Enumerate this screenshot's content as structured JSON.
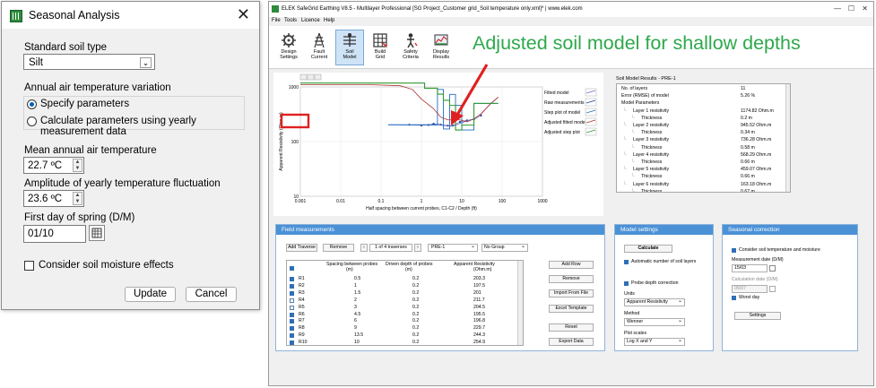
{
  "dialog": {
    "title": "Seasonal Analysis",
    "soil_type_label": "Standard soil type",
    "soil_type_value": "Silt",
    "air_temp_label": "Annual air temperature variation",
    "option_specify": "Specify parameters",
    "option_calculate": "Calculate parameters using yearly measurement data",
    "mean_temp_label": "Mean annual air temperature",
    "mean_temp_value": "22.7 ºC",
    "amplitude_label": "Amplitude of yearly temperature fluctuation",
    "amplitude_value": "23.6 ºC",
    "spring_label": "First day of spring (D/M)",
    "spring_value": "01/10",
    "moisture_label": "Consider soil moisture effects",
    "update_label": "Update",
    "cancel_label": "Cancel"
  },
  "app": {
    "title": "ELEK SafeGrid Earthing V8.5 - Multilayer Professional [SG Project_Customer grid_Soil temperature only.xml]* | www.elek.com",
    "menu": [
      "File",
      "Tools",
      "Licence",
      "Help"
    ],
    "ribbon": [
      {
        "l1": "Design",
        "l2": "Settings"
      },
      {
        "l1": "Fault",
        "l2": "Current"
      },
      {
        "l1": "Soil",
        "l2": "Model"
      },
      {
        "l1": "Build",
        "l2": "Grid"
      },
      {
        "l1": "Safety",
        "l2": "Criteria"
      },
      {
        "l1": "Display",
        "l2": "Results"
      }
    ],
    "annotation": "Adjusted soil model for shallow depths"
  },
  "chart_data": {
    "type": "line",
    "xlabel": "Half spacing between current probes, C1-C2 / Depth (ft)",
    "ylabel": "Apparent Resistivity (Ohm.m)",
    "xscale": "log",
    "yscale": "log",
    "xlim": [
      0.001,
      1000
    ],
    "ylim": [
      10,
      1000
    ],
    "x_ticks": [
      "0.001",
      "0.01",
      "0.1",
      "1",
      "10",
      "100",
      "1000"
    ],
    "y_ticks": [
      "1000",
      "100",
      "10"
    ],
    "legend": [
      "Fitted model",
      "Raw measurements",
      "Step plot of model",
      "Adjusted fitted model",
      "Adjusted step plot"
    ],
    "legend_position": "right",
    "series": [
      {
        "name": "Raw measurements",
        "x": [
          0.5,
          1,
          1.5,
          2,
          3,
          4.5,
          6,
          9,
          13.5,
          20,
          30
        ],
        "y": [
          203.3,
          197.5,
          201,
          211.7,
          204.5,
          195.5,
          196.8,
          229.7,
          244.3,
          254.9,
          300
        ]
      },
      {
        "name": "Fitted model",
        "x": [
          0.15,
          0.3,
          0.5,
          1,
          2,
          3,
          4.5,
          6,
          9,
          13.5,
          20,
          30,
          50,
          80
        ],
        "y": [
          203,
          202,
          201,
          201,
          202,
          200,
          193,
          192,
          215,
          240,
          260,
          320,
          480,
          650
        ]
      },
      {
        "name": "Step plot of model",
        "x": [
          0.15,
          2.5,
          2.5,
          3.5,
          3.5,
          5,
          5,
          7,
          7,
          10,
          10,
          20,
          20,
          80
        ],
        "y": [
          203,
          203,
          900,
          900,
          170,
          170,
          730,
          730,
          459,
          459,
          163,
          163,
          500,
          500
        ]
      },
      {
        "name": "Adjusted fitted model",
        "x": [
          0.001,
          0.05,
          0.3,
          0.6,
          1,
          2,
          3,
          4.5,
          6,
          9,
          13.5,
          20,
          30,
          50,
          80
        ],
        "y": [
          1100,
          1100,
          1050,
          900,
          600,
          400,
          280,
          250,
          250,
          250,
          230,
          260,
          320,
          480,
          650
        ]
      },
      {
        "name": "Adjusted step plot",
        "x": [
          0.001,
          1.2,
          1.2,
          2.5,
          2.5,
          3.5,
          3.5,
          5,
          5,
          7,
          7,
          10,
          10,
          20,
          20,
          80
        ],
        "y": [
          1174.82,
          1174.82,
          945.52,
          945.52,
          736.28,
          736.28,
          568.29,
          568.29,
          459.07,
          459.07,
          163.18,
          163.18,
          200,
          200,
          500,
          500
        ]
      }
    ]
  },
  "results": {
    "header": "Soil Model Results - PRE-1",
    "rows": [
      {
        "indent": 0,
        "label": "No. of layers",
        "value": "11"
      },
      {
        "indent": 0,
        "label": "Error (RMSE) of model",
        "value": "5.26 %"
      },
      {
        "indent": 0,
        "label": "Model Parameters",
        "value": ""
      },
      {
        "indent": 1,
        "label": "Layer 1 resistivity",
        "value": "1174.82 Ohm.m"
      },
      {
        "indent": 2,
        "label": "Thickness",
        "value": "0.2 m"
      },
      {
        "indent": 1,
        "label": "Layer 2 resistivity",
        "value": "945.52 Ohm.m"
      },
      {
        "indent": 2,
        "label": "Thickness",
        "value": "0.34 m"
      },
      {
        "indent": 1,
        "label": "Layer 3 resistivity",
        "value": "736.28 Ohm.m"
      },
      {
        "indent": 2,
        "label": "Thickness",
        "value": "0.58 m"
      },
      {
        "indent": 1,
        "label": "Layer 4 resistivity",
        "value": "568.29 Ohm.m"
      },
      {
        "indent": 2,
        "label": "Thickness",
        "value": "0.66 m"
      },
      {
        "indent": 1,
        "label": "Layer 5 resistivity",
        "value": "459.07 Ohm.m"
      },
      {
        "indent": 2,
        "label": "Thickness",
        "value": "0.66 m"
      },
      {
        "indent": 1,
        "label": "Layer 6 resistivity",
        "value": "163.18 Ohm.m"
      },
      {
        "indent": 2,
        "label": "Thickness",
        "value": "0.67 m"
      }
    ]
  },
  "field": {
    "header": "Field measurements",
    "add_traverse": "Add Traverse",
    "remove": "Remove",
    "traverse_count": "1 of 4 traverses",
    "traverse_name": "PRE-1",
    "group": "No Group",
    "columns": [
      "Spacing between probes\n(m)",
      "Driven depth of probes\n(m)",
      "Apparent Resistivity\n(Ohm.m)"
    ],
    "rows": [
      {
        "name": "R1",
        "s": "0.5",
        "d": "0.2",
        "r": "203.3",
        "on": true
      },
      {
        "name": "R2",
        "s": "1",
        "d": "0.2",
        "r": "197.5",
        "on": true
      },
      {
        "name": "R3",
        "s": "1.5",
        "d": "0.2",
        "r": "201",
        "on": true
      },
      {
        "name": "R4",
        "s": "2",
        "d": "0.2",
        "r": "211.7",
        "on": false
      },
      {
        "name": "R5",
        "s": "3",
        "d": "0.2",
        "r": "204.5",
        "on": false
      },
      {
        "name": "R6",
        "s": "4.5",
        "d": "0.2",
        "r": "195.5",
        "on": true
      },
      {
        "name": "R7",
        "s": "6",
        "d": "0.2",
        "r": "196.8",
        "on": true
      },
      {
        "name": "R8",
        "s": "9",
        "d": "0.2",
        "r": "229.7",
        "on": true
      },
      {
        "name": "R9",
        "s": "13.5",
        "d": "0.2",
        "r": "244.3",
        "on": true
      },
      {
        "name": "R10",
        "s": "10",
        "d": "0.2",
        "r": "254.9",
        "on": true
      }
    ],
    "buttons": [
      "Add Row",
      "Remove",
      "Import From File",
      "Excel Template",
      "Reset",
      "Export Data"
    ]
  },
  "model": {
    "header": "Model settings",
    "calculate": "Calculate",
    "auto_layers": "Automatic number of soil layers",
    "probe_corr": "Probe depth correction",
    "units_label": "Units",
    "units_value": "Apparent Resistivity",
    "method_label": "Method",
    "method_value": "Wenner",
    "scales_label": "Plot scales",
    "scales_value": "Log X and Y"
  },
  "seasonal": {
    "header": "Seasonal correction",
    "consider": "Consider soil temperature and moisture",
    "meas_label": "Measurement date (D/M)",
    "meas_value": "15/03",
    "calc_label": "Calculation date (D/M)",
    "calc_value": "05/07",
    "worst": "Worst day",
    "settings": "Settings"
  },
  "colors": {
    "accent": "#4b91d6",
    "annotation": "#2ea84c",
    "arrow": "#e02020",
    "green_line": "#2e9a2e",
    "blue_line": "#1f6fc0",
    "red_line": "#b03030"
  }
}
